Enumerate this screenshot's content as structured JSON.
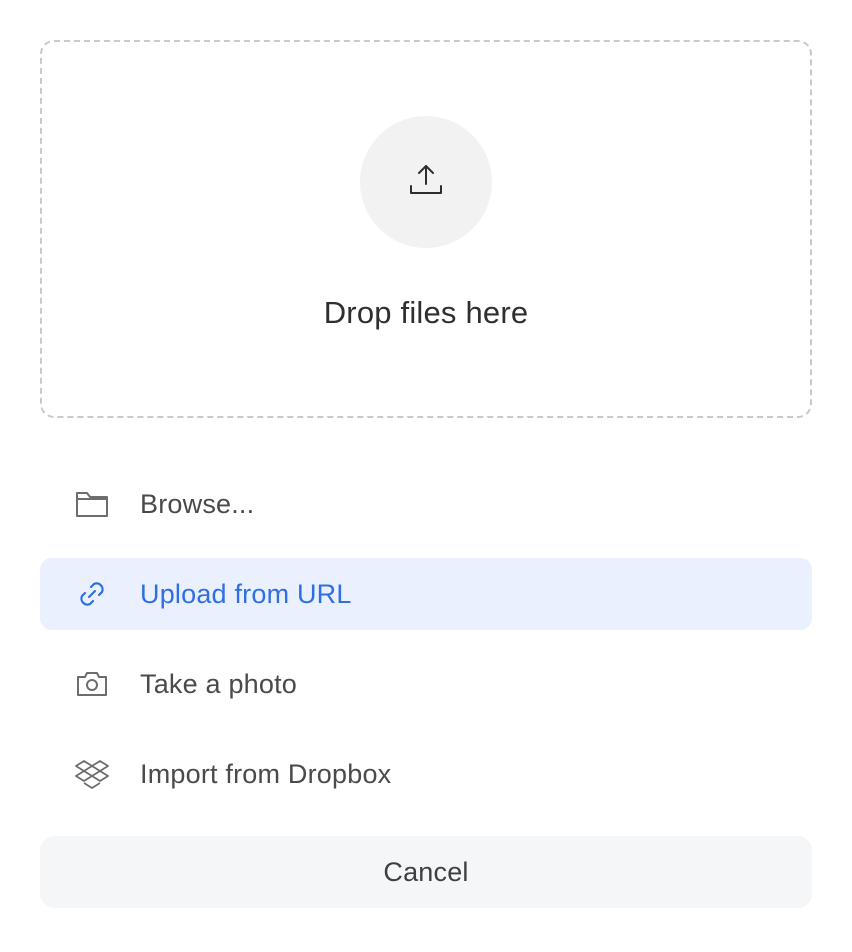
{
  "dropzone": {
    "title": "Drop files here",
    "icon": "upload-icon"
  },
  "options": [
    {
      "label": "Browse...",
      "icon": "folder-icon",
      "active": false
    },
    {
      "label": "Upload from URL",
      "icon": "link-icon",
      "active": true
    },
    {
      "label": "Take a photo",
      "icon": "camera-icon",
      "active": false
    },
    {
      "label": "Import from Dropbox",
      "icon": "dropbox-icon",
      "active": false
    }
  ],
  "cancel_label": "Cancel",
  "colors": {
    "accent": "#2f6fe4",
    "active_bg": "#eaf0fd",
    "cancel_bg": "#f5f6f8",
    "dropzone_border": "#c9c9c9"
  }
}
